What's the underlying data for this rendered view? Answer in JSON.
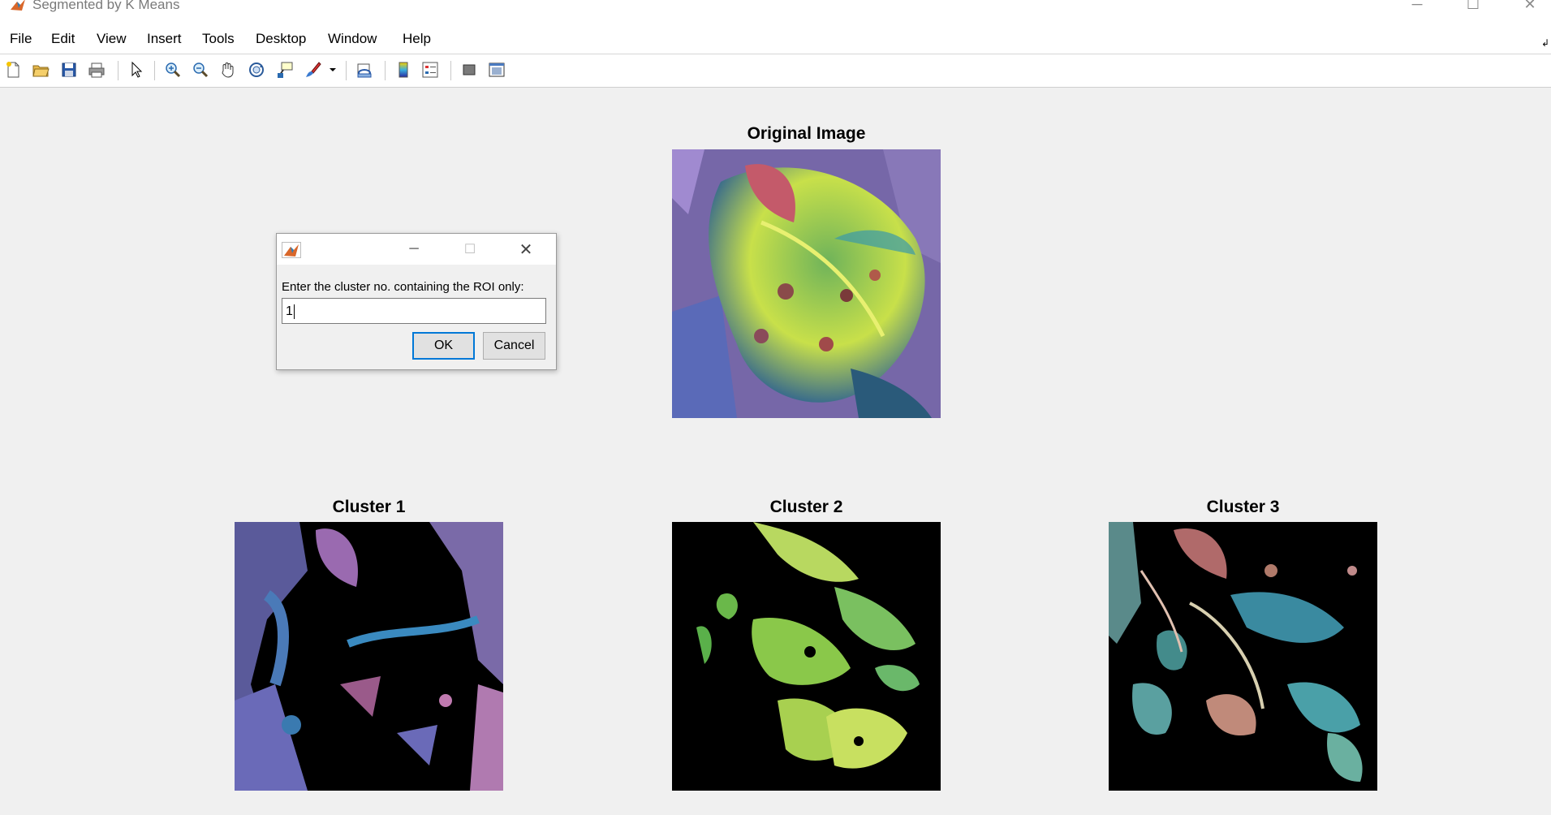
{
  "window": {
    "title": "Segmented by K Means",
    "controls": [
      "minimize",
      "maximize",
      "close"
    ]
  },
  "menubar": {
    "items": [
      "File",
      "Edit",
      "View",
      "Insert",
      "Tools",
      "Desktop",
      "Window",
      "Help"
    ]
  },
  "toolbar": {
    "icons": [
      "new-figure-icon",
      "open-file-icon",
      "save-icon",
      "print-icon",
      "edit-plot-icon",
      "zoom-in-icon",
      "zoom-out-icon",
      "pan-icon",
      "rotate-3d-icon",
      "data-cursor-icon",
      "brush-icon",
      "link-plot-icon",
      "insert-colorbar-icon",
      "insert-legend-icon",
      "hide-plot-tools-icon",
      "show-plot-tools-icon"
    ]
  },
  "axes": {
    "original": {
      "title": "Original Image"
    },
    "cluster1": {
      "title": "Cluster 1"
    },
    "cluster2": {
      "title": "Cluster 2"
    },
    "cluster3": {
      "title": "Cluster 3"
    }
  },
  "dialog": {
    "prompt": "Enter the cluster no. containing the ROI only:",
    "input_value": "1",
    "ok_label": "OK",
    "cancel_label": "Cancel"
  }
}
